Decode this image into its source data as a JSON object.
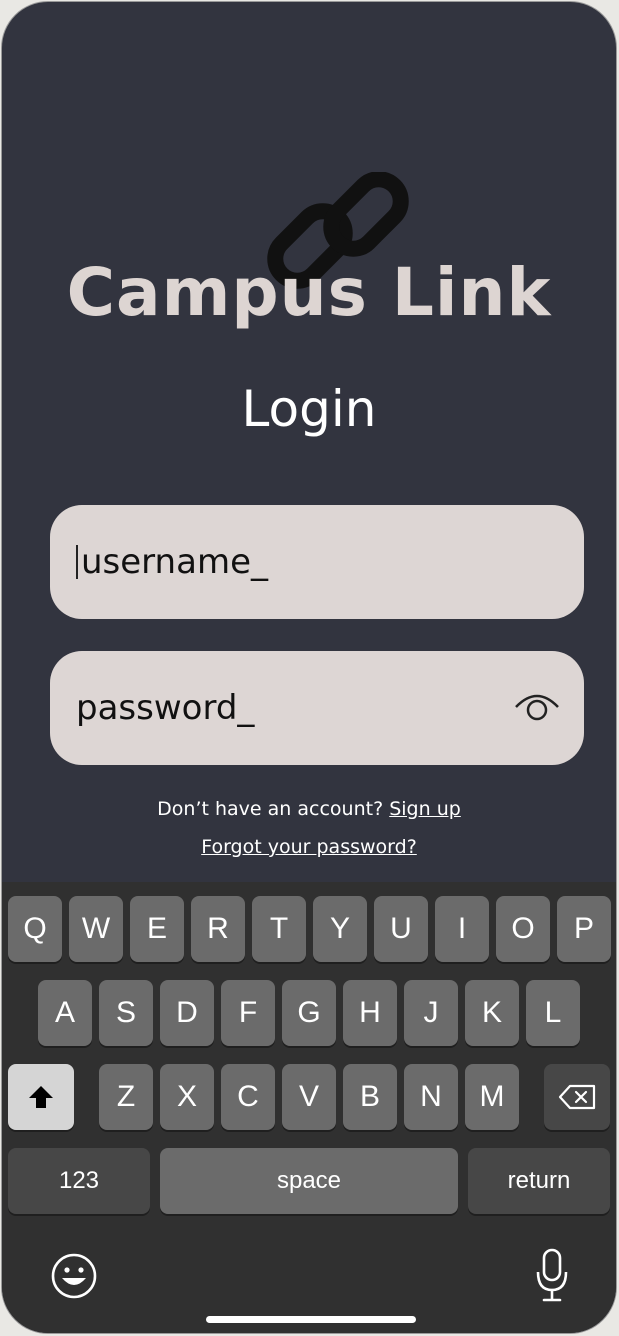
{
  "app": {
    "title": "Campus Link",
    "heading": "Login",
    "logo_icon": "chain-link-icon"
  },
  "form": {
    "username_value": "username_",
    "password_value": "password_",
    "password_toggle_icon": "eye-icon"
  },
  "links": {
    "no_account_text": "Don’t have an account?",
    "signup_label": "Sign up",
    "forgot_label": "Forgot your password?"
  },
  "keyboard": {
    "row1": [
      "Q",
      "W",
      "E",
      "R",
      "T",
      "Y",
      "U",
      "I",
      "O",
      "P"
    ],
    "row2": [
      "A",
      "S",
      "D",
      "F",
      "G",
      "H",
      "J",
      "K",
      "L"
    ],
    "row3": [
      "Z",
      "X",
      "C",
      "V",
      "B",
      "N",
      "M"
    ],
    "shift_icon": "shift-arrow-icon",
    "backspace_icon": "backspace-icon",
    "numbers_label": "123",
    "space_label": "space",
    "return_label": "return",
    "emoji_icon": "emoji-icon",
    "mic_icon": "microphone-icon"
  },
  "colors": {
    "background": "#32343f",
    "title": "#ddd5d2",
    "field": "#ddd6d4",
    "keyboard": "#303030",
    "key": "#6b6b6b"
  }
}
